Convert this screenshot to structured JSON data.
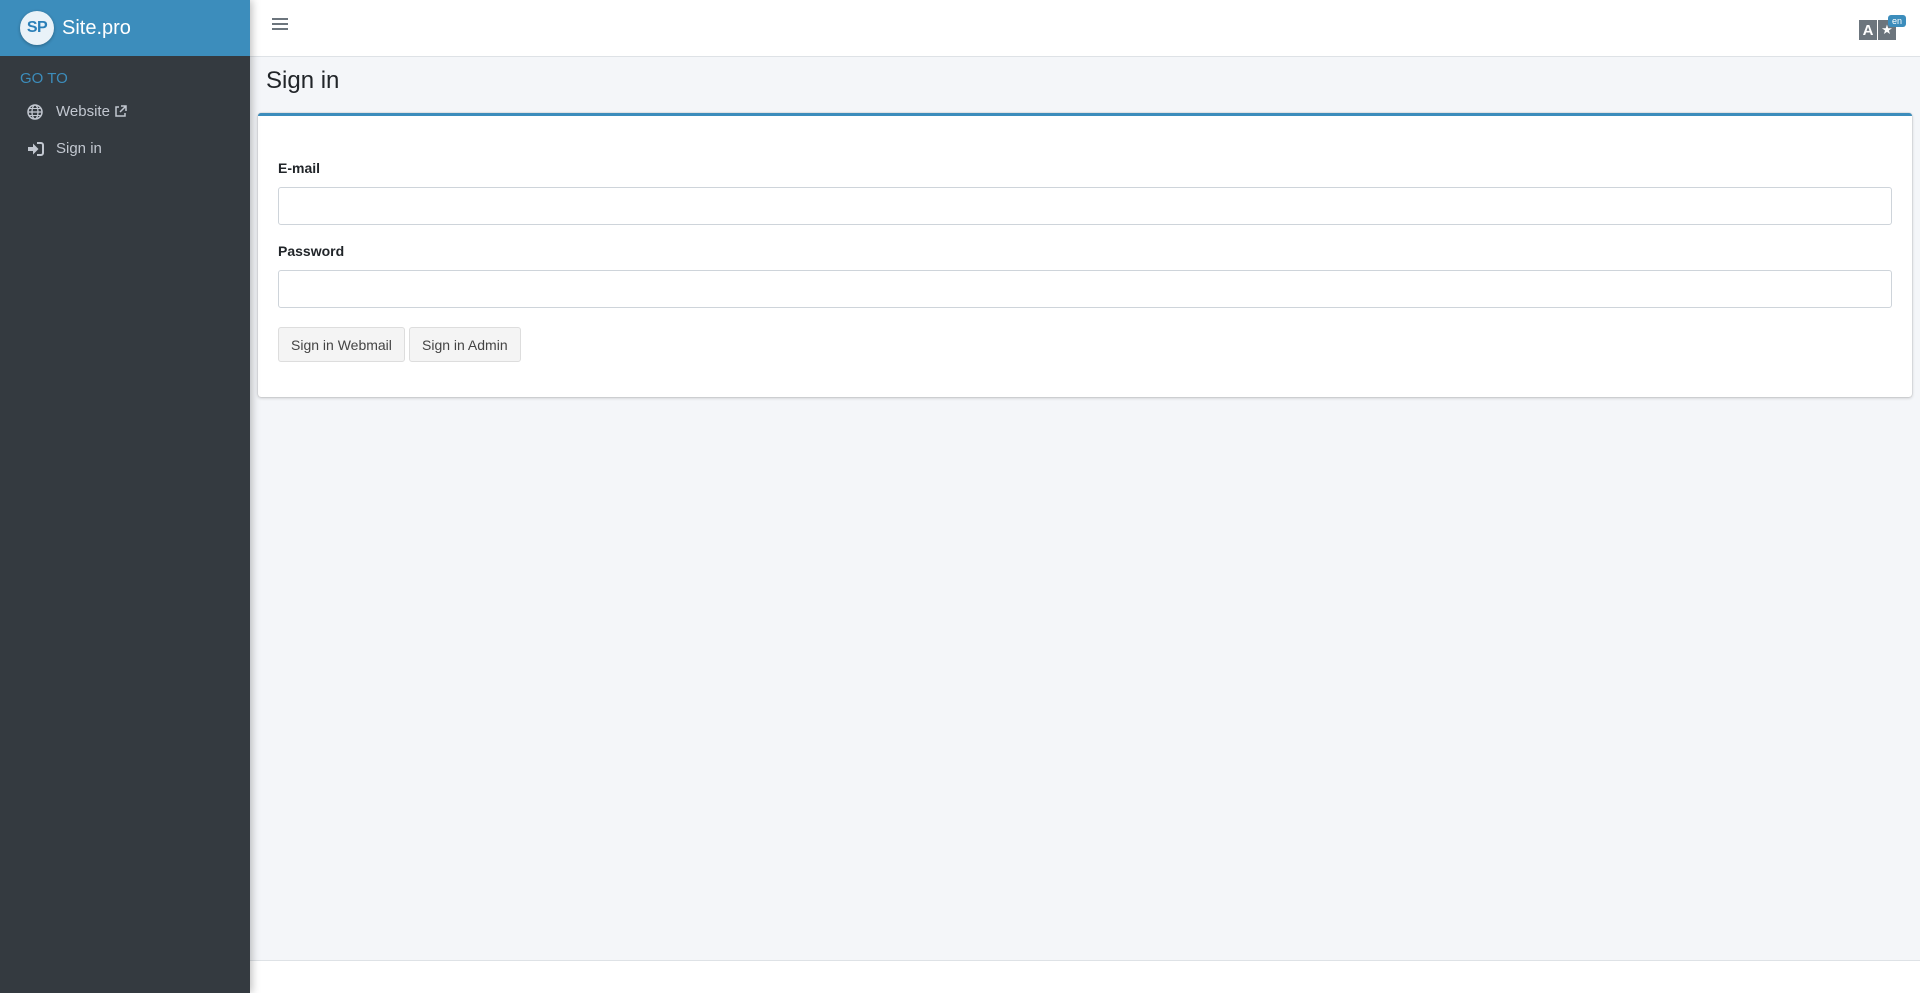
{
  "brand": {
    "logo_text": "SP",
    "name": "Site.pro"
  },
  "sidebar": {
    "header": "GO TO",
    "items": [
      {
        "label": "Website",
        "icon": "globe-icon",
        "external": true
      },
      {
        "label": "Sign in",
        "icon": "sign-in-icon",
        "external": false
      }
    ]
  },
  "topbar": {
    "language_badge": "en"
  },
  "page": {
    "title": "Sign in"
  },
  "form": {
    "email_label": "E-mail",
    "email_value": "",
    "password_label": "Password",
    "password_value": "",
    "webmail_button": "Sign in Webmail",
    "admin_button": "Sign in Admin"
  },
  "colors": {
    "accent": "#3c8dbc",
    "sidebar": "#343a40",
    "background": "#f4f6f9"
  }
}
